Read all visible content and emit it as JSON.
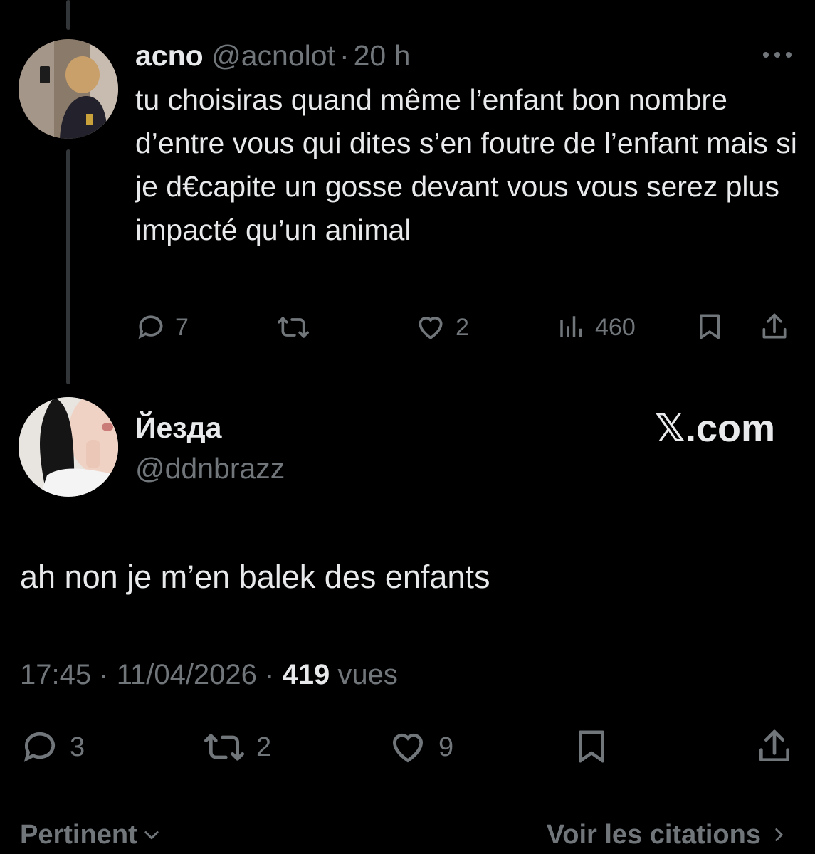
{
  "parent_tweet": {
    "display_name": "acno",
    "handle": "@acnolot",
    "separator": "·",
    "time_ago": "20 h",
    "more_icon": "more-dots-icon",
    "text": "tu choisiras quand même l’enfant bon nombre d’entre vous qui dites s’en foutre de l’enfant mais si je d€capite un gosse devant vous vous serez plus impacté qu’un animal",
    "actions": {
      "replies": "7",
      "retweets": "",
      "likes": "2",
      "views": "460"
    }
  },
  "main_tweet": {
    "display_name": "Йезда",
    "handle": "@ddnbrazz",
    "brand": "𝕏.com",
    "text": "ah non je m’en balek des enfants",
    "time": "17:45",
    "date": "11/04/2026",
    "separator": "·",
    "views_count": "419",
    "views_label": "vues",
    "actions": {
      "replies": "3",
      "retweets": "2",
      "likes": "9"
    }
  },
  "footer": {
    "sort_label": "Pertinent",
    "quotes_label": "Voir les citations"
  },
  "colors": {
    "background": "#000000",
    "text": "#e7e9ea",
    "muted": "#71767b",
    "thread_line": "#333639"
  }
}
